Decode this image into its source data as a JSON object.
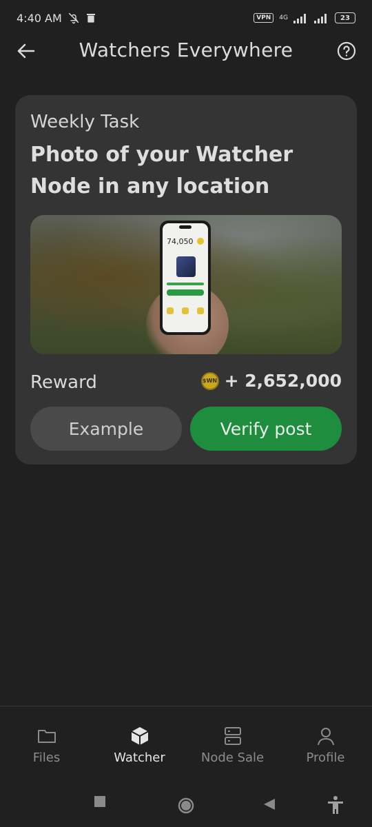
{
  "status_bar": {
    "time": "4:40 AM",
    "vpn": "VPN",
    "network": "4G",
    "battery": "23",
    "icons": [
      "bell-off-icon",
      "trash-icon",
      "signal-icon",
      "signal-icon"
    ]
  },
  "app_bar": {
    "title": "Watchers Everywhere",
    "back_icon": "arrow-left-icon",
    "help_icon": "help-circle-icon"
  },
  "task_card": {
    "type": "Weekly Task",
    "title": "Photo of your Watcher Node in any location",
    "image": {
      "phone_value": "74,050"
    },
    "reward_label": "Reward",
    "reward_currency": "$WN",
    "reward_value": "+ 2,652,000",
    "example_button": "Example",
    "verify_button": "Verify post"
  },
  "bottom_nav": {
    "items": [
      {
        "label": "Files",
        "icon": "folder-icon",
        "active": false
      },
      {
        "label": "Watcher",
        "icon": "cube-icon",
        "active": true
      },
      {
        "label": "Node Sale",
        "icon": "server-icon",
        "active": false
      },
      {
        "label": "Profile",
        "icon": "user-icon",
        "active": false
      }
    ]
  },
  "colors": {
    "background": "#202020",
    "card": "#343434",
    "accent_green": "#1e8e3e",
    "coin_gold": "#c9a820"
  }
}
